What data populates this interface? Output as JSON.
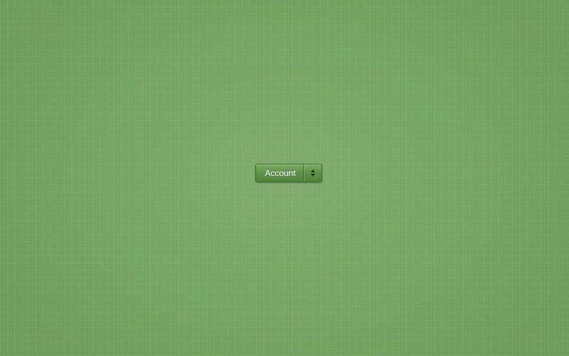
{
  "background": {
    "color": "#77a563"
  },
  "select": {
    "selected_value": "Account",
    "arrow_icon": "up-down-arrows-icon"
  }
}
